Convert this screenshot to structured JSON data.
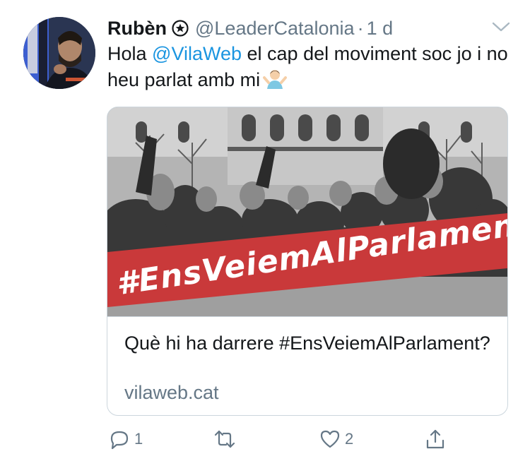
{
  "tweet": {
    "author_name": "Rubèn",
    "author_handle": "@LeaderCatalonia",
    "separator": "·",
    "time": "1 d",
    "text_prefix": "Hola ",
    "mention": "@VilaWeb",
    "text_suffix": " el cap del moviment soc jo i no heu parlat amb mi",
    "emoji": "person-shrugging-emoji"
  },
  "card": {
    "banner_text": "#EnsVeiemAlParlament",
    "title": "Què hi ha darrere #EnsVeiemAlParlament?",
    "domain": "vilaweb.cat"
  },
  "actions": {
    "reply_count": "1",
    "retweet_count": "",
    "like_count": "2"
  },
  "icons": {
    "verified_badge": "star-badge-icon",
    "more": "chevron-down-icon",
    "reply": "reply-icon",
    "retweet": "retweet-icon",
    "like": "heart-icon",
    "share": "share-icon"
  },
  "colors": {
    "text": "#14171a",
    "secondary": "#657786",
    "link": "#1b95e0",
    "border": "#ccd6dd",
    "banner_red": "#c9393a"
  }
}
